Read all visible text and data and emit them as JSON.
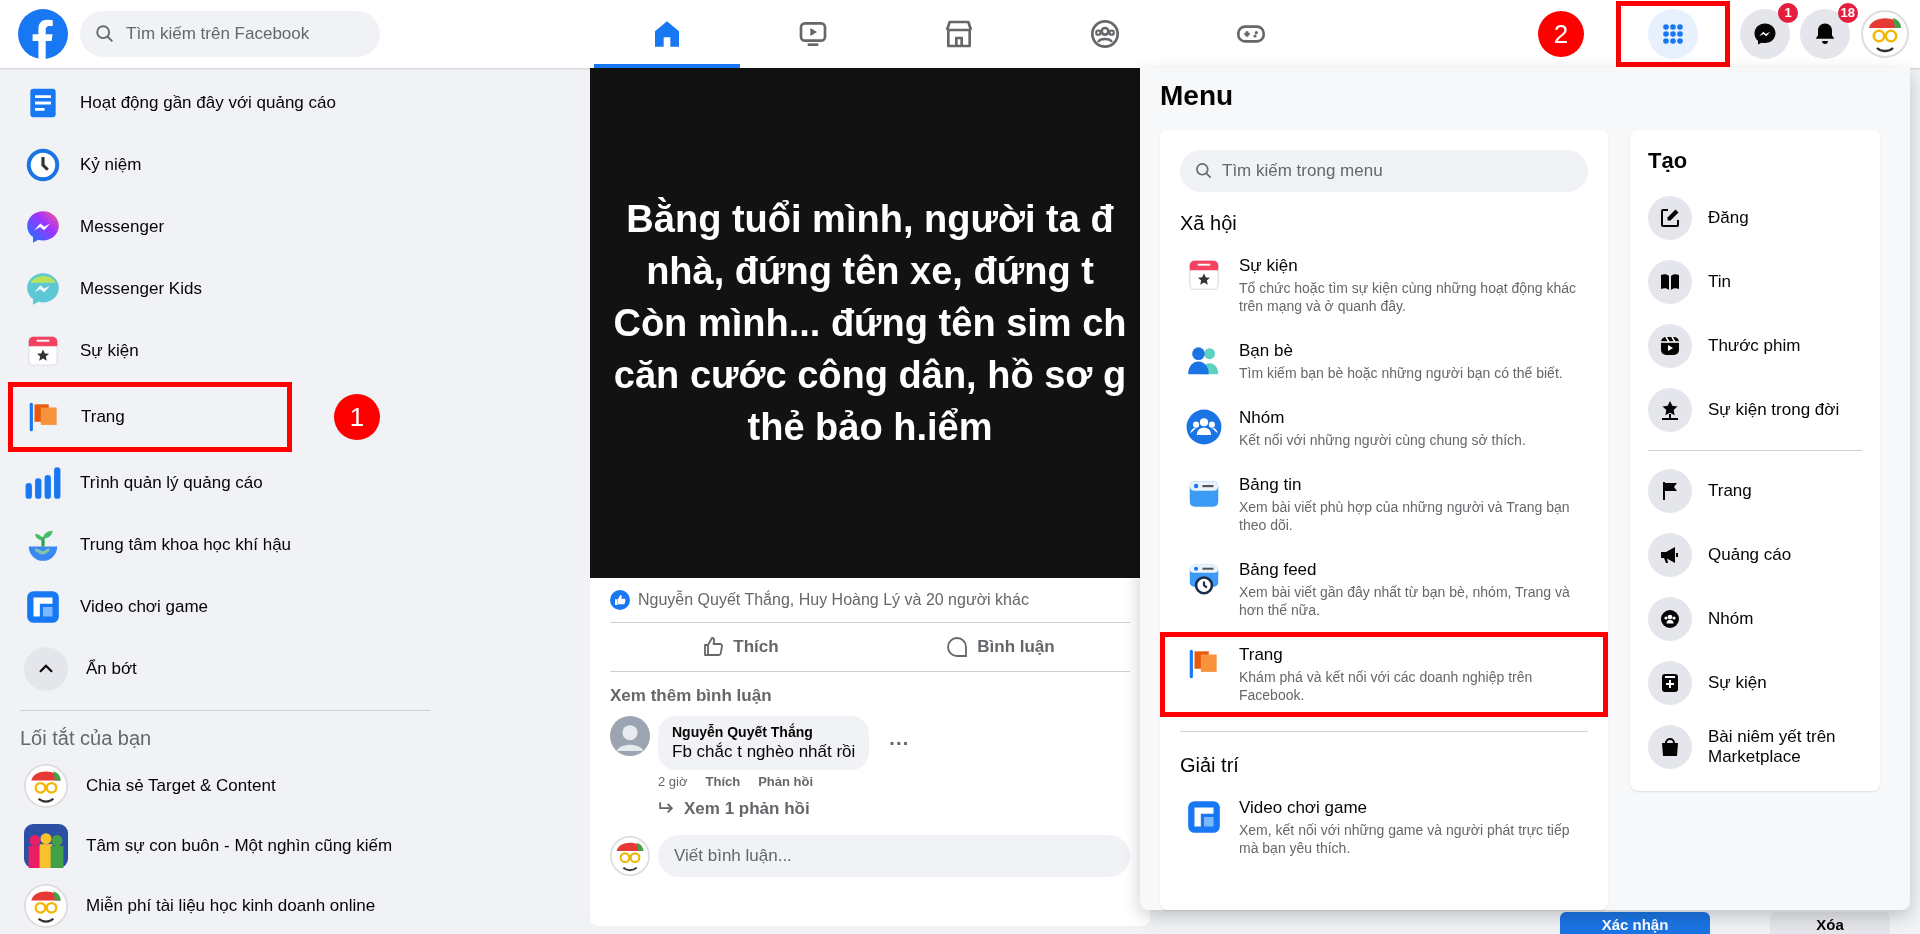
{
  "topbar": {
    "search": {
      "placeholder": "Tìm kiếm trên Facebook"
    },
    "nav_tabs": [
      {
        "kind": "home",
        "selected": true
      },
      {
        "kind": "video",
        "selected": false
      },
      {
        "kind": "store",
        "selected": false
      },
      {
        "kind": "groups",
        "selected": false
      },
      {
        "kind": "gaming",
        "selected": false
      }
    ],
    "actions": [
      {
        "kind": "grid",
        "selected": true,
        "highlighted": true,
        "annotation": "2"
      },
      {
        "kind": "messenger",
        "selected": false,
        "highlighted": false,
        "badge": "1"
      },
      {
        "kind": "bell",
        "selected": false,
        "highlighted": false,
        "badge": "18"
      },
      {
        "kind": "avatar",
        "selected": false,
        "highlighted": false
      }
    ]
  },
  "sidebar": {
    "items": [
      {
        "label": "Hoạt động gần đây với quảng cáo",
        "kind": "ad-activity",
        "highlighted": false
      },
      {
        "label": "Kỷ niệm",
        "kind": "memories",
        "highlighted": false
      },
      {
        "label": "Messenger",
        "kind": "messenger-app",
        "highlighted": false
      },
      {
        "label": "Messenger Kids",
        "kind": "messenger-kids",
        "highlighted": false
      },
      {
        "label": "Sự kiện",
        "kind": "events",
        "highlighted": false
      },
      {
        "label": "Trang",
        "kind": "pages",
        "highlighted": true,
        "annotation": "1"
      },
      {
        "label": "Trình quản lý quảng cáo",
        "kind": "ads-manager",
        "highlighted": false
      },
      {
        "label": "Trung tâm khoa học khí hậu",
        "kind": "climate",
        "highlighted": false
      },
      {
        "label": "Video chơi game",
        "kind": "gaming-app",
        "highlighted": false
      },
      {
        "label": "Ẩn bớt",
        "kind": "collapse",
        "highlighted": false
      }
    ],
    "shortcuts_title": "Lối tắt của bạn",
    "shortcuts": [
      {
        "label": "Chia sẻ Target & Content",
        "kind": "avatar"
      },
      {
        "label": "Tâm sự con buôn - Một nghìn cũng kiếm",
        "kind": "group"
      },
      {
        "label": "Miễn phí tài liệu học kinh doanh online",
        "kind": "avatar"
      }
    ]
  },
  "post": {
    "image_lines": [
      "Bằng tuổi mình, người ta đ",
      "nhà, đứng tên xe, đứng t",
      "Còn mình... đứng tên sim ch",
      "căn cước công dân, hồ sơ g",
      "thẻ bảo h.iểm"
    ],
    "reactions": "Nguyễn Quyết Thắng, Huy Hoàng Lý và 20 người khác",
    "actions": [
      {
        "kind": "like",
        "label": "Thích"
      },
      {
        "kind": "comment",
        "label": "Bình luận"
      }
    ],
    "more_comments": "Xem thêm bình luận",
    "comment": {
      "author": "Nguyễn Quyết Thắng",
      "text": "Fb chắc t nghèo nhất rồi",
      "more": "···",
      "time": "2 giờ",
      "actions": [
        "Thích",
        "Phản hồi"
      ],
      "replies": "Xem 1 phản hồi"
    },
    "comment_input": {
      "placeholder": "Viết bình luận..."
    }
  },
  "menu": {
    "title": "Menu",
    "search": {
      "placeholder": "Tìm kiếm trong menu"
    },
    "sections": [
      {
        "title": "Xã hội",
        "items": [
          {
            "title": "Sự kiện",
            "description": "Tổ chức hoặc tìm sự kiện cùng những hoạt động khác trên mạng và ở quanh đây.",
            "kind": "events",
            "highlighted": false
          },
          {
            "title": "Bạn bè",
            "description": "Tìm kiếm bạn bè hoặc những người bạn có thể biết.",
            "kind": "friends",
            "highlighted": false
          },
          {
            "title": "Nhóm",
            "description": "Kết nối với những người cùng chung sở thích.",
            "kind": "groups-circle",
            "highlighted": false
          },
          {
            "title": "Bảng tin",
            "description": "Xem bài viết phù hợp của những người và Trang bạn theo dõi.",
            "kind": "feed",
            "highlighted": false
          },
          {
            "title": "Bảng feed",
            "description": "Xem bài viết gần đây nhất từ bạn bè, nhóm, Trang và hơn thế nữa.",
            "kind": "feeds",
            "highlighted": false
          },
          {
            "title": "Trang",
            "description": "Khám phá và kết nối với các doanh nghiệp trên Facebook.",
            "kind": "pages",
            "highlighted": true
          }
        ]
      },
      {
        "title": "Giải trí",
        "items": [
          {
            "title": "Video chơi game",
            "description": "Xem, kết nối với những game và người phát trực tiếp mà bạn yêu thích.",
            "kind": "gaming-app",
            "highlighted": false
          }
        ]
      }
    ],
    "create": {
      "title": "Tạo",
      "groups": [
        [
          {
            "label": "Đăng",
            "kind": "edit"
          },
          {
            "label": "Tin",
            "kind": "book"
          },
          {
            "label": "Thước phim",
            "kind": "reels"
          },
          {
            "label": "Sự kiện trong đời",
            "kind": "star"
          }
        ],
        [
          {
            "label": "Trang",
            "kind": "flag"
          },
          {
            "label": "Quảng cáo",
            "kind": "megaphone"
          },
          {
            "label": "Nhóm",
            "kind": "group-dark"
          },
          {
            "label": "Sự kiện",
            "kind": "plus"
          },
          {
            "label": "Bài niêm yết trên Marketplace",
            "kind": "bag"
          }
        ]
      ]
    }
  },
  "request_buttons": [
    {
      "label": "Xác nhận",
      "kind": "primary"
    },
    {
      "label": "Xóa",
      "kind": "secondary"
    }
  ]
}
